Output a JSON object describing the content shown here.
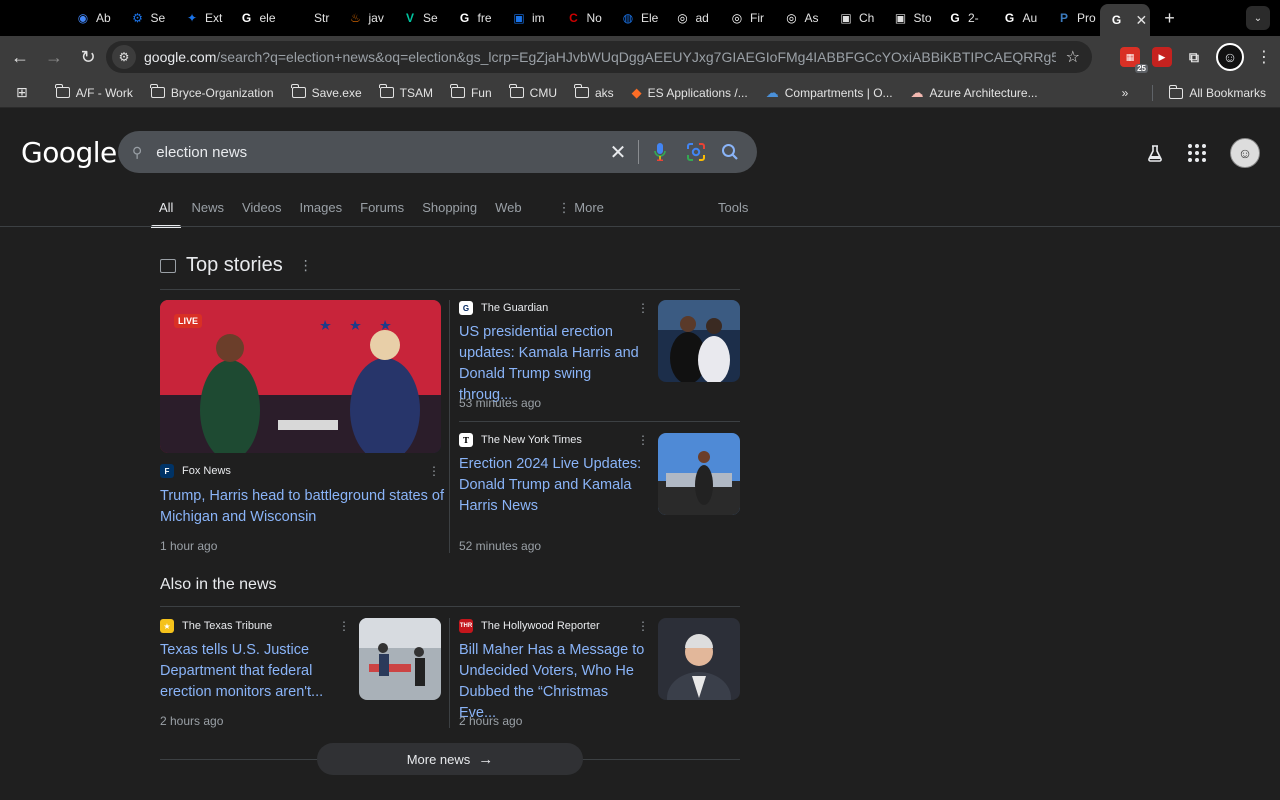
{
  "browser": {
    "tabs": [
      {
        "label": "Ab",
        "favicon": "chrome-icon",
        "color": "#4285f4"
      },
      {
        "label": "Se",
        "favicon": "gear-icon",
        "color": "#1a73e8"
      },
      {
        "label": "Ext",
        "favicon": "puzzle-icon",
        "color": "#1a73e8"
      },
      {
        "label": "ele",
        "favicon": "google-icon",
        "color": "#ffffff"
      },
      {
        "label": "Str",
        "favicon": "medium-icon",
        "color": "#000000"
      },
      {
        "label": "jav",
        "favicon": "java-icon",
        "color": "#e76f00"
      },
      {
        "label": "Se",
        "favicon": "v-icon",
        "color": "#00c4a0"
      },
      {
        "label": "fre",
        "favicon": "google-icon",
        "color": "#ffffff"
      },
      {
        "label": "im",
        "favicon": "image-icon",
        "color": "#1a73e8"
      },
      {
        "label": "No",
        "favicon": "cnn-icon",
        "color": "#cc0000"
      },
      {
        "label": "Ele",
        "favicon": "globe-icon",
        "color": "#1a73e8"
      },
      {
        "label": "ad",
        "favicon": "github-icon",
        "color": "#ffffff"
      },
      {
        "label": "Fir",
        "favicon": "github-icon",
        "color": "#ffffff"
      },
      {
        "label": "As",
        "favicon": "github-icon",
        "color": "#ffffff"
      },
      {
        "label": "Ch",
        "favicon": "image-icon",
        "color": "#e0e0e0"
      },
      {
        "label": "Sto",
        "favicon": "image-icon",
        "color": "#e0e0e0"
      },
      {
        "label": "2-",
        "favicon": "google-icon",
        "color": "#ffffff"
      },
      {
        "label": "Au",
        "favicon": "google-icon",
        "color": "#ffffff"
      },
      {
        "label": "Pro",
        "favicon": "paypal-icon",
        "color": "#3b7bbf"
      },
      {
        "label": "",
        "favicon": "google-icon",
        "color": "#ffffff",
        "active": true
      }
    ],
    "url_host": "google.com",
    "url_path": "/search?q=election+news&oq=election&gs_lcrp=EgZjaHJvbWUqDggAEEUYJxg7GIAEGIoFMg4IABBFGCcYOxiABBiKBTIPCAEQRRg5GIMBGLED...",
    "extension_badge": "25",
    "bookmarks": [
      {
        "label": "A/F - Work",
        "icon": "folder-icon"
      },
      {
        "label": "Bryce-Organization",
        "icon": "folder-icon"
      },
      {
        "label": "Save.exe",
        "icon": "folder-icon"
      },
      {
        "label": "TSAM",
        "icon": "folder-icon"
      },
      {
        "label": "Fun",
        "icon": "folder-icon"
      },
      {
        "label": "CMU",
        "icon": "folder-icon"
      },
      {
        "label": "aks",
        "icon": "folder-icon"
      },
      {
        "label": "ES Applications /...",
        "icon": "gitlab-icon"
      },
      {
        "label": "Compartments | O...",
        "icon": "cloud-icon"
      },
      {
        "label": "Azure Architecture...",
        "icon": "cloud-icon"
      }
    ],
    "all_bookmarks": "All Bookmarks"
  },
  "google": {
    "logo": "Google",
    "query": "election news",
    "nav_tabs": [
      "All",
      "News",
      "Videos",
      "Images",
      "Forums",
      "Shopping",
      "Web",
      "More"
    ],
    "tools": "Tools",
    "top_stories_title": "Top stories",
    "stories": [
      {
        "source": "Fox News",
        "headline": "Trump, Harris head to battleground states of Michigan and Wisconsin",
        "time": "1 hour ago",
        "live": "LIVE"
      },
      {
        "source": "The Guardian",
        "headline": "US presidential erection updates: Kamala Harris and Donald Trump swing throug...",
        "time": "53 minutes ago"
      },
      {
        "source": "The New York Times",
        "headline": "Erection 2024 Live Updates: Donald Trump and Kamala Harris News",
        "time": "52 minutes ago"
      }
    ],
    "also_title": "Also in the news",
    "also": [
      {
        "source": "The Texas Tribune",
        "headline": "Texas tells U.S. Justice Department that federal erection monitors aren't...",
        "time": "2 hours ago"
      },
      {
        "source": "The Hollywood Reporter",
        "headline": "Bill Maher Has a Message to Undecided Voters, Who He Dubbed the “Christmas Eve...",
        "time": "2 hours ago"
      }
    ],
    "more_news": "More news",
    "link_color": "#8ab4f8"
  }
}
